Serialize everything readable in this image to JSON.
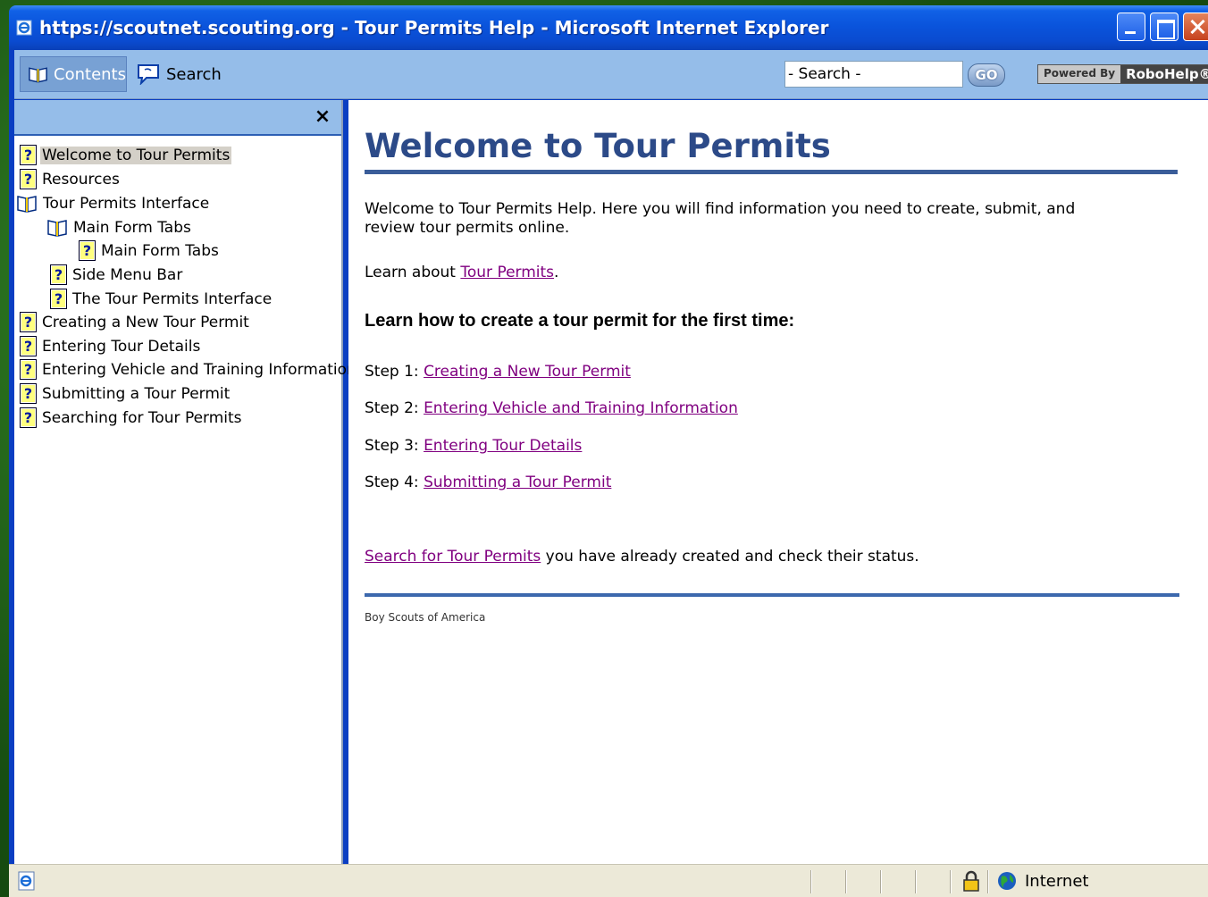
{
  "window": {
    "title": "https://scoutnet.scouting.org - Tour Permits Help - Microsoft Internet Explorer"
  },
  "toolbar": {
    "contents_label": "Contents",
    "search_tab_label": "Search",
    "search_value": "- Search -",
    "go_label": "GO",
    "powered_by": "Powered By",
    "brand": "RoboHelp®"
  },
  "toc": {
    "close_glyph": "×",
    "items": [
      {
        "label": "Welcome to Tour Permits",
        "icon": "help-topic-icon",
        "selected": true
      },
      {
        "label": "Resources",
        "icon": "help-topic-icon"
      },
      {
        "label": "Tour Permits Interface",
        "icon": "open-book-icon"
      },
      {
        "label": "Main Form Tabs",
        "icon": "open-book-icon"
      },
      {
        "label": "Main Form Tabs",
        "icon": "help-topic-icon"
      },
      {
        "label": "Side Menu Bar",
        "icon": "help-topic-icon"
      },
      {
        "label": "The Tour Permits Interface",
        "icon": "help-topic-icon"
      },
      {
        "label": "Creating a New Tour Permit",
        "icon": "help-topic-icon"
      },
      {
        "label": "Entering Tour Details",
        "icon": "help-topic-icon"
      },
      {
        "label": "Entering Vehicle and Training Information",
        "icon": "help-topic-icon"
      },
      {
        "label": "Submitting a Tour Permit",
        "icon": "help-topic-icon"
      },
      {
        "label": "Searching for Tour Permits",
        "icon": "help-topic-icon"
      }
    ]
  },
  "content": {
    "title": "Welcome to Tour Permits",
    "intro_line1": "Welcome to Tour Permits Help. Here you will find information you need to create, submit, and",
    "intro_line2": "review tour permits online.",
    "learn_prefix": "Learn about ",
    "learn_link": "Tour Permits",
    "learn_suffix": ".",
    "subheading": "Learn how to create a tour permit for the first time:",
    "steps": [
      {
        "prefix": "Step 1: ",
        "link": "Creating a New Tour Permit"
      },
      {
        "prefix": "Step 2: ",
        "link": "Entering Vehicle and Training Information"
      },
      {
        "prefix": "Step 3: ",
        "link": "Entering Tour Details"
      },
      {
        "prefix": "Step 4: ",
        "link": "Submitting a Tour Permit"
      }
    ],
    "search_link": "Search for Tour Permits",
    "search_suffix": " you have already created and check their status.",
    "footer": "Boy Scouts of America"
  },
  "statusbar": {
    "zone": "Internet"
  },
  "colors": {
    "titlebar": "#0a54dc",
    "heading": "#2c4a88",
    "link_visited": "#800080",
    "rule": "#3a5d99"
  }
}
